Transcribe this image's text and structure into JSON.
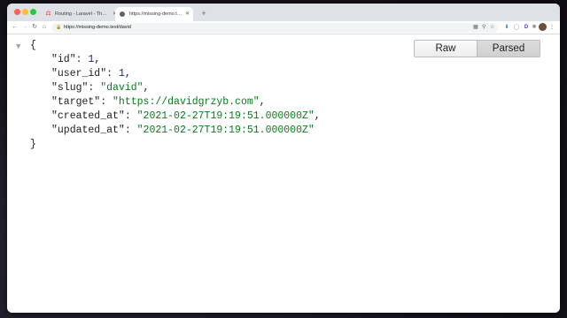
{
  "tabs": [
    {
      "title": "Routing - Laravel - The PHP F",
      "favicon": "laravel-icon",
      "active": false
    },
    {
      "title": "https://missing-demo.test/da",
      "favicon": "globe-icon",
      "active": true
    }
  ],
  "toolbar": {
    "url": "https://missing-demo.test/david"
  },
  "viewer": {
    "raw_label": "Raw",
    "parsed_label": "Parsed",
    "selected": "Parsed"
  },
  "json": {
    "open_brace": "{",
    "close_brace": "}",
    "entries": [
      {
        "key": "\"id\"",
        "value": "1",
        "type": "number",
        "comma": ","
      },
      {
        "key": "\"user_id\"",
        "value": "1",
        "type": "number",
        "comma": ","
      },
      {
        "key": "\"slug\"",
        "value": "\"david\"",
        "type": "string",
        "comma": ","
      },
      {
        "key": "\"target\"",
        "value": "\"https://davidgrzyb.com\"",
        "type": "string",
        "comma": ","
      },
      {
        "key": "\"created_at\"",
        "value": "\"2021-02-27T19:19:51.000000Z\"",
        "type": "string",
        "comma": ","
      },
      {
        "key": "\"updated_at\"",
        "value": "\"2021-02-27T19:19:51.000000Z\"",
        "type": "string",
        "comma": ""
      }
    ]
  },
  "colors": {
    "number": "#1a1aa6",
    "string": "#0b7a1b"
  }
}
